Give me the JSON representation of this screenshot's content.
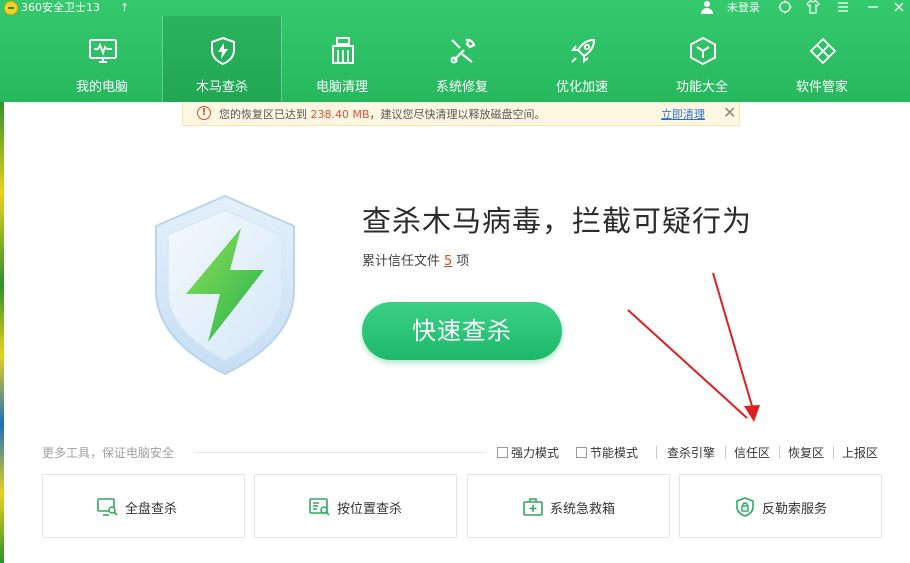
{
  "title_bar": {
    "app_title": "360安全卫士13",
    "upgrade_icon": "up-arrow-icon",
    "login_text": "未登录",
    "buttons": [
      "skin-icon",
      "shirt-icon",
      "menu-icon",
      "minimize-icon",
      "close-icon"
    ]
  },
  "nav": {
    "items": [
      {
        "label": "我的电脑",
        "icon": "monitor-pulse-icon"
      },
      {
        "label": "木马查杀",
        "icon": "shield-bolt-icon",
        "active": true
      },
      {
        "label": "电脑清理",
        "icon": "broom-icon"
      },
      {
        "label": "系统修复",
        "icon": "wrench-icon"
      },
      {
        "label": "优化加速",
        "icon": "rocket-icon"
      },
      {
        "label": "功能大全",
        "icon": "cube-icon"
      },
      {
        "label": "软件管家",
        "icon": "apps-icon"
      }
    ]
  },
  "notice": {
    "prefix": "您的恢复区已达到 ",
    "size": "238.40 MB",
    "suffix": "，建议您尽快清理以释放磁盘空间。",
    "link": "立即清理",
    "close": "✕"
  },
  "main": {
    "headline": "查杀木马病毒，拦截可疑行为",
    "trusted_prefix": "累计信任文件",
    "trusted_count": "5",
    "trusted_suffix": "项",
    "scan_button": "快速查杀"
  },
  "tools": {
    "caption": "更多工具，保证电脑安全",
    "options": [
      {
        "label": "强力模式",
        "checked": false
      },
      {
        "label": "节能模式",
        "checked": false
      }
    ],
    "links": [
      "查杀引擎",
      "信任区",
      "恢复区",
      "上报区"
    ],
    "cards": [
      {
        "label": "全盘查杀",
        "icon": "monitor-search-icon"
      },
      {
        "label": "按位置查杀",
        "icon": "folder-search-icon"
      },
      {
        "label": "系统急救箱",
        "icon": "first-aid-kit-icon"
      },
      {
        "label": "反勒索服务",
        "icon": "shield-lock-icon"
      }
    ]
  },
  "colors": {
    "header_green": "#2ec265",
    "button_green": "#27c07a",
    "warning_red": "#e24a2c",
    "arrow_red": "#e02020"
  }
}
